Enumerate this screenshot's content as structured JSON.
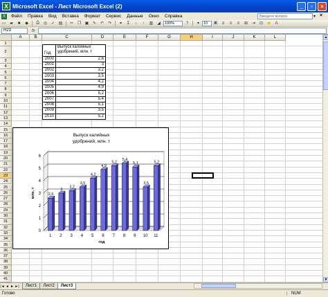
{
  "window": {
    "title": "Microsoft Excel - Лист Microsoft Excel (2)",
    "minimize": "_",
    "restore": "▫",
    "close": "×"
  },
  "menu": {
    "items": [
      "Файл",
      "Правка",
      "Вид",
      "Вставка",
      "Формат",
      "Сервис",
      "Данные",
      "Окно",
      "Справка"
    ],
    "help_placeholder": "Введите вопрос",
    "close": "×"
  },
  "toolbar": {
    "zoom": "100%",
    "font_size": "10"
  },
  "formula_bar": {
    "name_box": "H23",
    "fx": "fx"
  },
  "sheet": {
    "columns": [
      "A",
      "B",
      "C",
      "D",
      "E",
      "F",
      "G",
      "H",
      "I",
      "J",
      "K",
      "L"
    ],
    "selected_column": "H",
    "rows": [
      "1",
      "2",
      "3",
      "4",
      "5",
      "6",
      "7",
      "8",
      "9",
      "10",
      "11",
      "12",
      "13",
      "14",
      "15",
      "16",
      "17",
      "18",
      "19",
      "20",
      "21",
      "22",
      "23",
      "24",
      "25",
      "26",
      "27",
      "28",
      "29",
      "30",
      "31",
      "32",
      "33",
      "34",
      "35",
      "36",
      "37",
      "38",
      "39",
      "40",
      "41",
      "42"
    ],
    "selected_row": "23",
    "table": {
      "header_year": "Год",
      "header_value": "Выпуск калийных удобрений, млн. т",
      "rows": [
        {
          "year": "2000",
          "value": "2,6"
        },
        {
          "year": "2001",
          "value": "3"
        },
        {
          "year": "2002",
          "value": "3,2"
        },
        {
          "year": "2003",
          "value": "3,5"
        },
        {
          "year": "2004",
          "value": "4,2"
        },
        {
          "year": "2005",
          "value": "4,9"
        },
        {
          "year": "2006",
          "value": "5,2"
        },
        {
          "year": "2007",
          "value": "5,4"
        },
        {
          "year": "2008",
          "value": "5,1"
        },
        {
          "year": "2009",
          "value": "3,5"
        },
        {
          "year": "2010",
          "value": "5,2"
        }
      ]
    }
  },
  "chart_data": {
    "type": "bar",
    "title": "Выпуск калийных удобрений, млн. т",
    "title_line1": "Выпуск калийных",
    "title_line2": "удобрений, млн. т",
    "xlabel": "год",
    "ylabel": "млн. т",
    "categories": [
      "1",
      "2",
      "3",
      "4",
      "5",
      "6",
      "7",
      "8",
      "9",
      "10",
      "11"
    ],
    "values": [
      2.6,
      3,
      3.2,
      3.5,
      4.2,
      4.9,
      5.2,
      5.4,
      5.1,
      3.5,
      5.2
    ],
    "data_labels": [
      "2,6",
      "3",
      "3,2",
      "3,5",
      "4,2",
      "4,9",
      "5,2",
      "5,4",
      "5,1",
      "3,5",
      "5,2"
    ],
    "ylim": [
      0,
      6
    ],
    "yticks": [
      "0",
      "1",
      "2",
      "3",
      "4",
      "5",
      "6"
    ],
    "bar_color": "#6b6bdc",
    "grid": true
  },
  "tabs": {
    "nav": [
      "|◄",
      "◄",
      "►",
      "►|"
    ],
    "items": [
      "Лист1",
      "Лист2",
      "Лист3"
    ],
    "active": "Лист3"
  },
  "status": {
    "text": "Готово",
    "num": "NUM"
  }
}
